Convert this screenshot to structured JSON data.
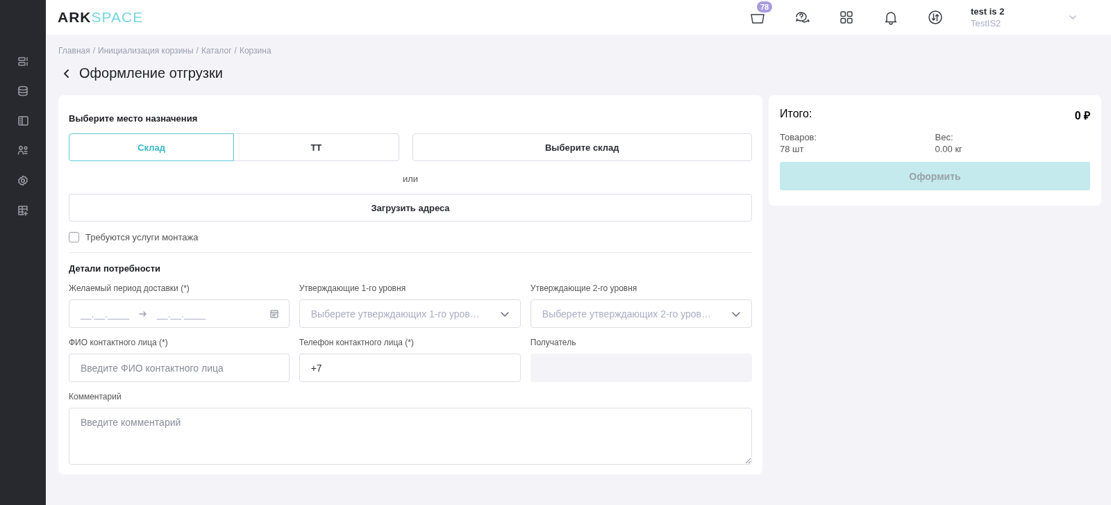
{
  "header": {
    "logo": {
      "dark": "ARK",
      "light": "SPACE"
    },
    "cart_count": "78",
    "user": {
      "name": "test is 2",
      "org": "TestIS2"
    }
  },
  "breadcrumbs": [
    "Главная",
    "Инициализация корзины",
    "Каталог",
    "Корзина"
  ],
  "separator": "/",
  "page_title": "Оформление отгрузки",
  "destination": {
    "heading": "Выберите место назначения",
    "tabs": [
      {
        "label": "Склад",
        "selected": true
      },
      {
        "label": "ТТ",
        "selected": false
      }
    ],
    "warehouse_button": "Выберите склад",
    "or": "или",
    "upload_button": "Загрузить адреса",
    "mounting": {
      "label": "Требуются услуги монтажа",
      "checked": false
    }
  },
  "details": {
    "heading": "Детали потребности",
    "fields": [
      {
        "kind": "daterange",
        "label": "Желаемый период доставки (*)",
        "from": "__.__.____",
        "to": "__.__.____"
      },
      {
        "kind": "select",
        "label": "Утверждающие 1-го уровня",
        "placeholder": "Выберете утверждающих 1-го уров…"
      },
      {
        "kind": "select",
        "label": "Утверждающие 2-го уровня",
        "placeholder": "Выберете утверждающих 2-го уров…"
      },
      {
        "kind": "text",
        "label": "ФИО контактного лица (*)",
        "placeholder": "Введите ФИО контактного лица"
      },
      {
        "kind": "text",
        "label": "Телефон контактного лица (*)",
        "value": "+7"
      },
      {
        "kind": "readonly",
        "label": "Получатель"
      }
    ],
    "comment": {
      "label": "Комментарий",
      "placeholder": "Введите комментарий"
    }
  },
  "summary": {
    "title": "Итого:",
    "total": "0 ₽",
    "items_label": "Товаров:",
    "items_value": "78 шт",
    "weight_label": "Вес:",
    "weight_value": "0.00 кг",
    "submit": {
      "label": "Оформить",
      "disabled": true
    }
  }
}
